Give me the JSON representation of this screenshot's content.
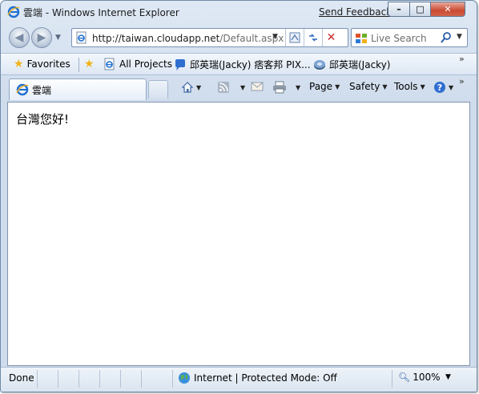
{
  "window": {
    "title": "雲端 - Windows Internet Explorer",
    "send_feedback": "Send Feedback",
    "caption": {
      "minimize": "–",
      "maximize": "□",
      "close": "✕"
    }
  },
  "navigation": {
    "back": "◀",
    "forward": "▶",
    "address": {
      "url_host": "http://taiwan.cloudapp.net",
      "url_path": "/Default.aspx"
    },
    "search": {
      "placeholder": "Live Search"
    }
  },
  "favorites_bar": {
    "favorites_label": "Favorites",
    "items": [
      {
        "label": "All Projects",
        "icon": "ie-page-icon"
      },
      {
        "label": "邱英瑞(Jacky) 痞客邦 PIX...",
        "icon": "speech-bubble-icon"
      },
      {
        "label": "邱英瑞(Jacky)",
        "icon": "globe-disk-icon"
      }
    ],
    "chevron": "»"
  },
  "tabs": [
    {
      "label": "雲端",
      "active": true
    }
  ],
  "command_bar": {
    "page": "Page",
    "safety": "Safety",
    "tools": "Tools",
    "help_icon": "help-icon",
    "chevron": "»"
  },
  "content": {
    "greeting": "台灣您好!"
  },
  "status_bar": {
    "status": "Done",
    "zone": "Internet | Protected Mode: Off",
    "zoom": "100%"
  },
  "colors": {
    "frame": "#dfe9f5",
    "close_button": "#c94a31",
    "ie_blue": "#1e6fd1"
  }
}
